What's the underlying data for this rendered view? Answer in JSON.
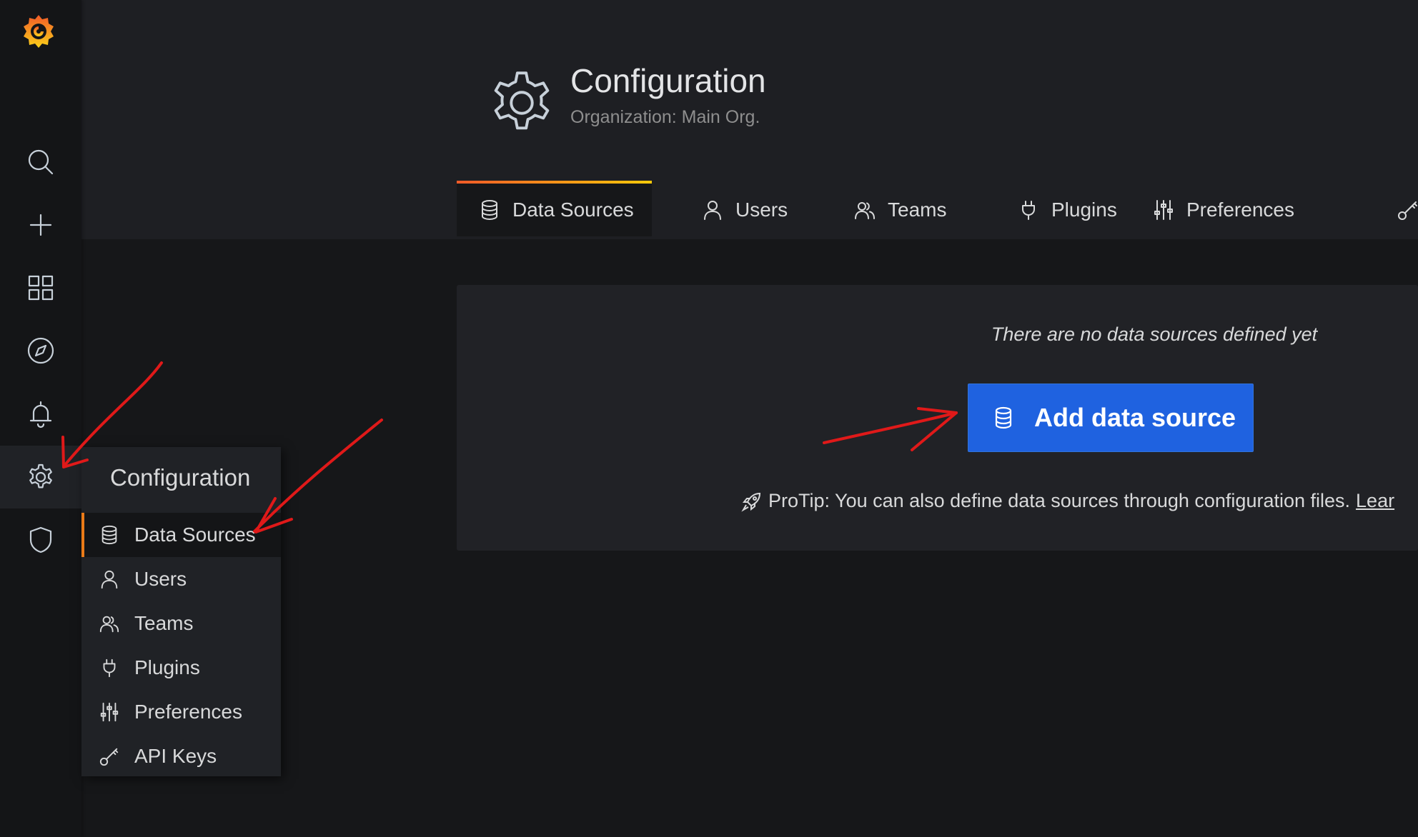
{
  "app": {
    "accent": "#f05a28",
    "primary_button": "#1f62e0",
    "active_marker": "#eb7b18",
    "annotation_color": "#e01919"
  },
  "sidebar": {
    "logo_icon": "grafana-logo-icon",
    "items": [
      {
        "icon": "search-icon"
      },
      {
        "icon": "plus-icon"
      },
      {
        "icon": "dashboards-grid-icon"
      },
      {
        "icon": "compass-explore-icon"
      },
      {
        "icon": "bell-alerting-icon"
      },
      {
        "icon": "gear-icon",
        "active": true
      },
      {
        "icon": "shield-icon"
      }
    ]
  },
  "header": {
    "icon": "gear-icon",
    "title": "Configuration",
    "subtitle": "Organization: Main Org.",
    "tabs": [
      {
        "label": "Data Sources",
        "icon": "database-icon",
        "active": true
      },
      {
        "label": "Users",
        "icon": "user-icon"
      },
      {
        "label": "Teams",
        "icon": "users-icon"
      },
      {
        "label": "Plugins",
        "icon": "plug-icon"
      },
      {
        "label": "Preferences",
        "icon": "sliders-icon"
      },
      {
        "label": "",
        "icon": "key-icon"
      }
    ]
  },
  "main": {
    "empty_message": "There are no data sources defined yet",
    "cta_label": "Add data source",
    "cta_icon": "database-icon",
    "protip_text": "ProTip: You can also define data sources through configuration files.",
    "protip_link": "Lear"
  },
  "dropdown": {
    "title": "Configuration",
    "items": [
      {
        "label": "Data Sources",
        "icon": "database-icon",
        "active": true
      },
      {
        "label": "Users",
        "icon": "user-icon"
      },
      {
        "label": "Teams",
        "icon": "users-icon"
      },
      {
        "label": "Plugins",
        "icon": "plug-icon"
      },
      {
        "label": "Preferences",
        "icon": "sliders-icon"
      },
      {
        "label": "API Keys",
        "icon": "key-icon"
      }
    ]
  }
}
